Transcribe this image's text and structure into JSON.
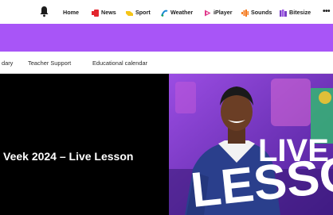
{
  "top_nav": {
    "items": [
      {
        "label": "Home",
        "icon": "home"
      },
      {
        "label": "News",
        "icon": "news-icon",
        "color": "#e3262e"
      },
      {
        "label": "Sport",
        "icon": "sport-icon",
        "color": "#f5c518"
      },
      {
        "label": "Weather",
        "icon": "weather-icon",
        "color": "#1a8ad4"
      },
      {
        "label": "iPlayer",
        "icon": "iplayer-icon",
        "color": "#e0368a"
      },
      {
        "label": "Sounds",
        "icon": "sounds-icon",
        "color": "#f47b20"
      },
      {
        "label": "Bitesize",
        "icon": "bitesize-icon",
        "color": "#7b3fc7"
      }
    ],
    "more_label": "•••"
  },
  "sub_nav": {
    "items": [
      "dary",
      "Teacher Support",
      "Educational calendar"
    ]
  },
  "hero": {
    "title": "Veek 2024 – Live Lesson",
    "banner_text_line1": "LIVE",
    "banner_text_line2": "LESSO"
  },
  "colors": {
    "accent_band": "#a855f7",
    "hero_left_bg": "#000000"
  }
}
